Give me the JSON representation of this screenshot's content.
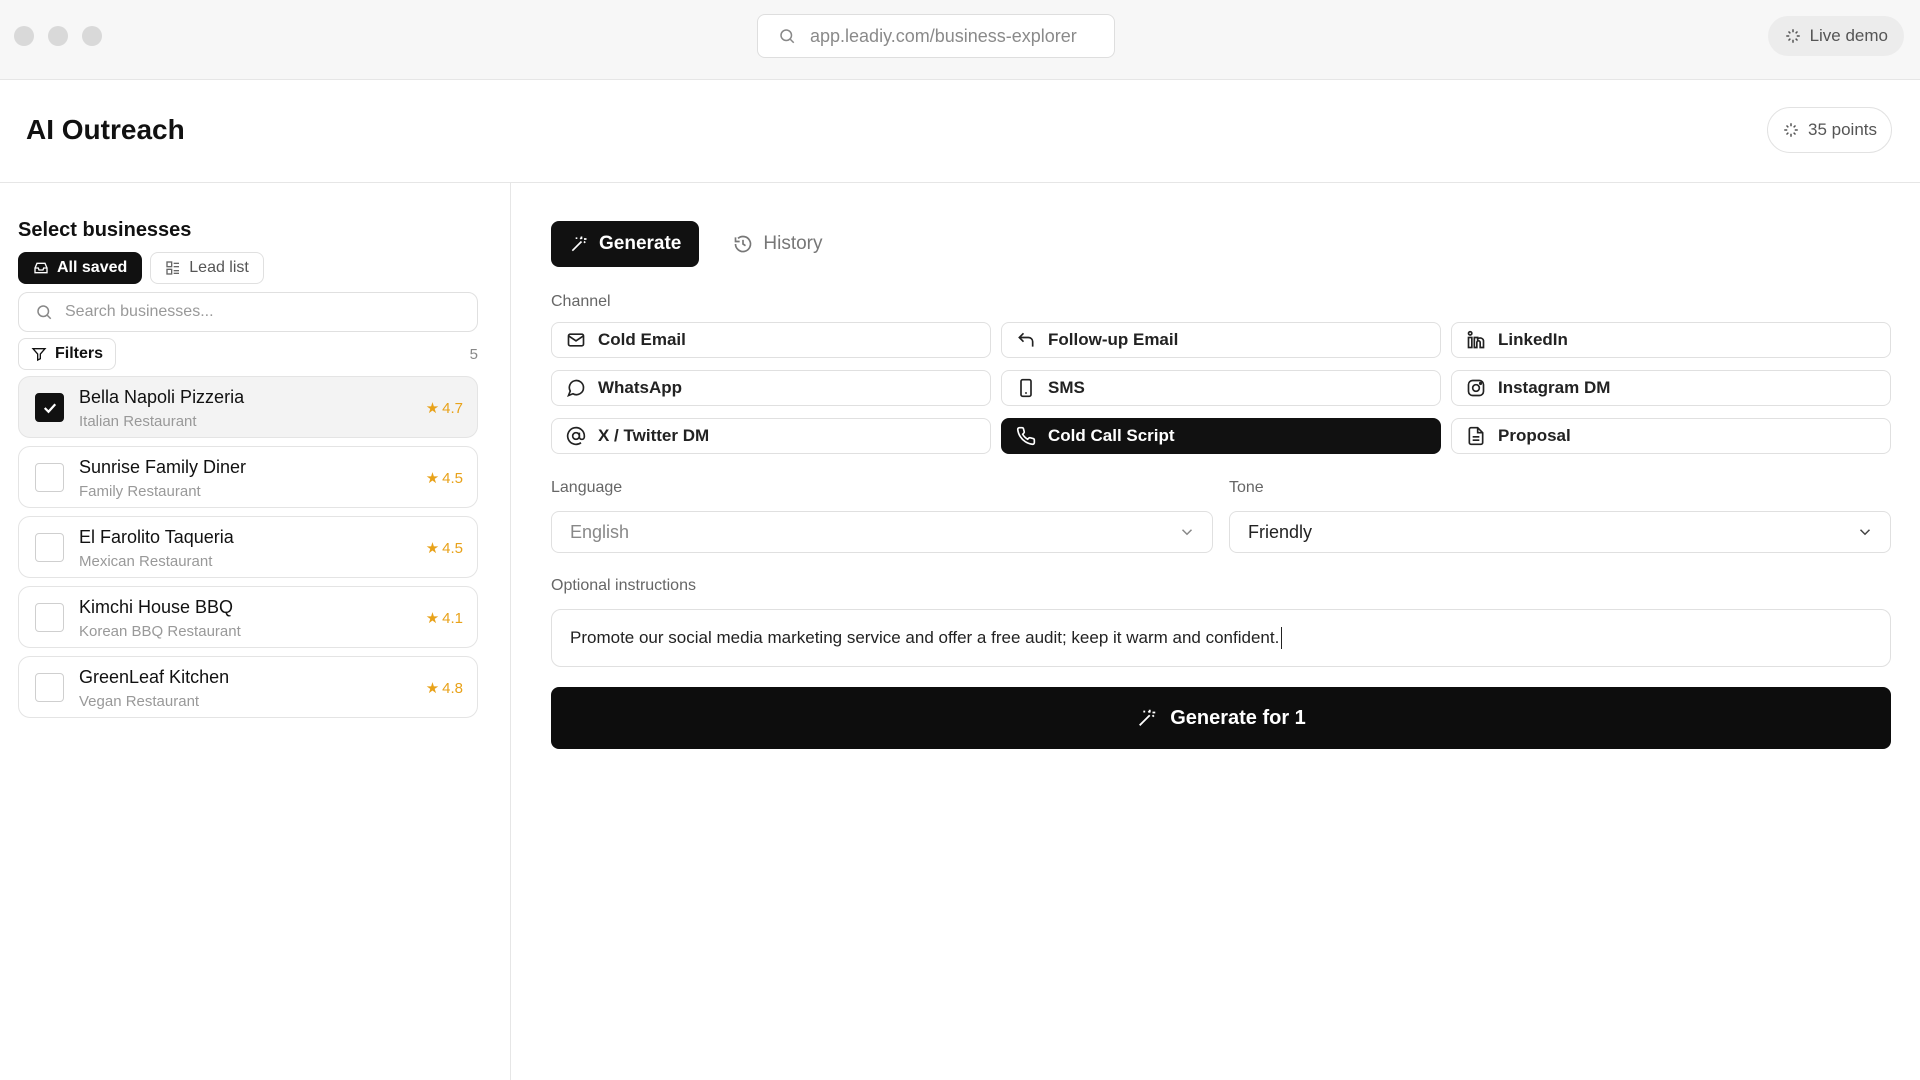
{
  "browser": {
    "url": "app.leadiy.com/business-explorer",
    "live_demo_label": "Live demo"
  },
  "header": {
    "title": "AI Outreach",
    "points_label": "35 points"
  },
  "sidebar": {
    "heading": "Select businesses",
    "segments": [
      {
        "label": "All saved",
        "active": true
      },
      {
        "label": "Lead list",
        "active": false
      }
    ],
    "search_placeholder": "Search businesses...",
    "filters_label": "Filters",
    "count": "5",
    "businesses": [
      {
        "name": "Bella Napoli Pizzeria",
        "type": "Italian Restaurant",
        "rating": "4.7",
        "checked": true
      },
      {
        "name": "Sunrise Family Diner",
        "type": "Family Restaurant",
        "rating": "4.5",
        "checked": false
      },
      {
        "name": "El Farolito Taqueria",
        "type": "Mexican Restaurant",
        "rating": "4.5",
        "checked": false
      },
      {
        "name": "Kimchi House BBQ",
        "type": "Korean BBQ Restaurant",
        "rating": "4.1",
        "checked": false
      },
      {
        "name": "GreenLeaf Kitchen",
        "type": "Vegan Restaurant",
        "rating": "4.8",
        "checked": false
      }
    ]
  },
  "main": {
    "tabs": [
      {
        "label": "Generate",
        "active": true
      },
      {
        "label": "History",
        "active": false
      }
    ],
    "channel_label": "Channel",
    "channels": [
      {
        "label": "Cold Email",
        "icon": "mail-icon",
        "active": false
      },
      {
        "label": "Follow-up Email",
        "icon": "reply-icon",
        "active": false
      },
      {
        "label": "LinkedIn",
        "icon": "linkedin-icon",
        "active": false
      },
      {
        "label": "WhatsApp",
        "icon": "message-circle-icon",
        "active": false
      },
      {
        "label": "SMS",
        "icon": "phone-device-icon",
        "active": false
      },
      {
        "label": "Instagram DM",
        "icon": "instagram-icon",
        "active": false
      },
      {
        "label": "X / Twitter DM",
        "icon": "at-sign-icon",
        "active": false
      },
      {
        "label": "Cold Call Script",
        "icon": "phone-icon",
        "active": true
      },
      {
        "label": "Proposal",
        "icon": "document-icon",
        "active": false
      }
    ],
    "language_label": "Language",
    "language_value": "English",
    "tone_label": "Tone",
    "tone_value": "Friendly",
    "instructions_label": "Optional instructions",
    "instructions_value": "Promote our social media marketing service and offer a free audit; keep it warm and confident.",
    "generate_label": "Generate for 1"
  },
  "colors": {
    "primary": "#111111",
    "star": "#e8a21a",
    "border": "#e0e0e0"
  }
}
